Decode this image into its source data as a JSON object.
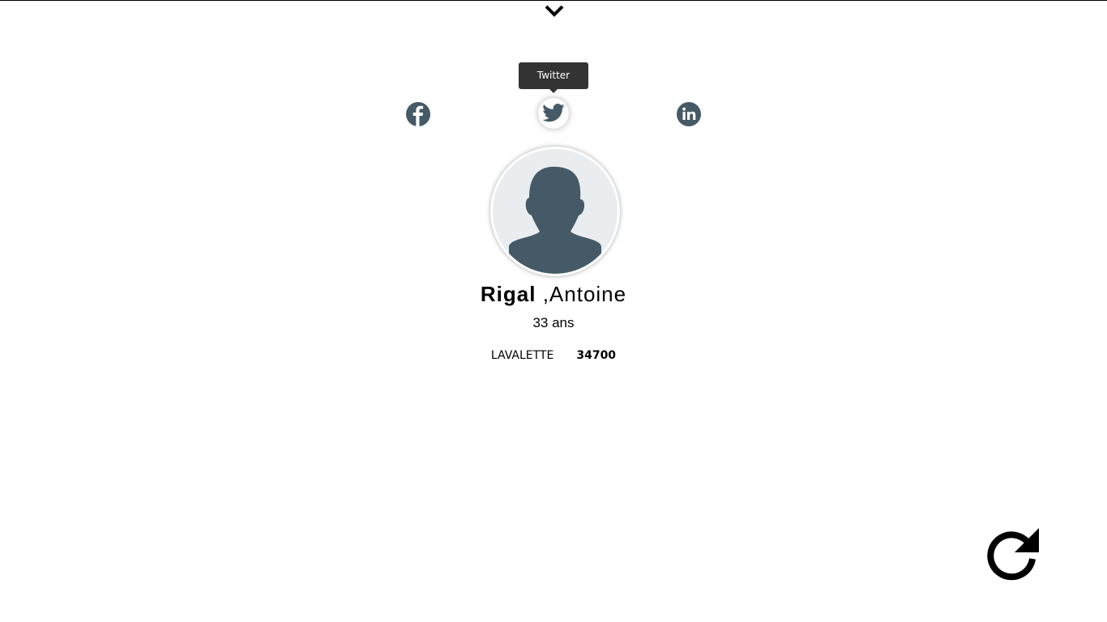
{
  "tooltip": "Twitter",
  "profile": {
    "last_name": "Rigal",
    "separator": " ,",
    "first_name": "Antoine",
    "age": "33 ans",
    "city": "LAVALETTE",
    "postal_code": "34700"
  },
  "colors": {
    "icon": "#455a66",
    "tooltip_bg": "#333333"
  },
  "icons": [
    "chevron-down-icon",
    "facebook-icon",
    "twitter-icon",
    "linkedin-icon",
    "avatar-placeholder-icon",
    "refresh-icon"
  ]
}
